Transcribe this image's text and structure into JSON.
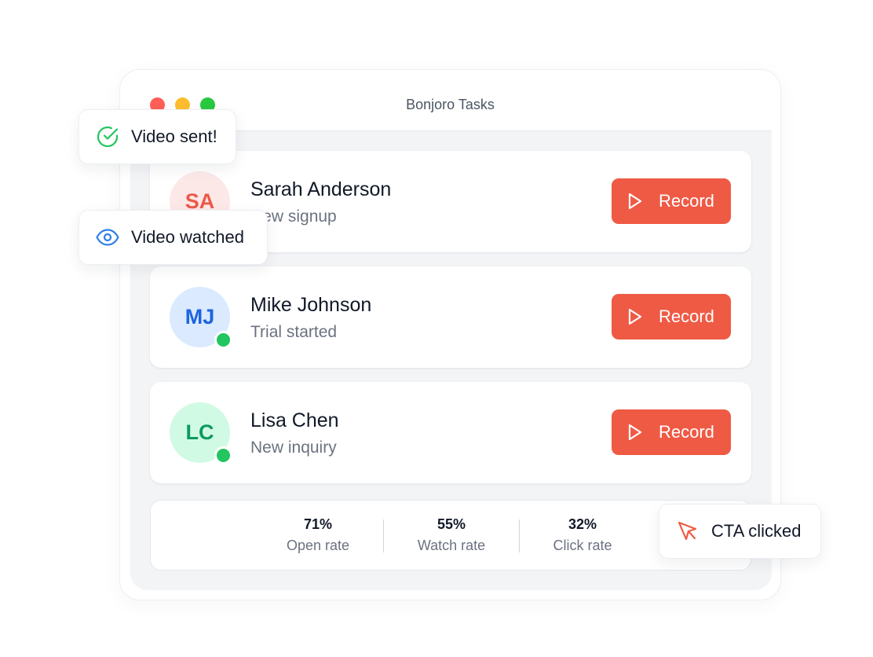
{
  "window": {
    "title": "Bonjoro Tasks"
  },
  "tasks": [
    {
      "initials": "SA",
      "name": "Sarah Anderson",
      "subtitle": "New signup",
      "action": "Record",
      "avatar_color": "#ea5a47",
      "online": false
    },
    {
      "initials": "MJ",
      "name": "Mike Johnson",
      "subtitle": "Trial started",
      "action": "Record",
      "avatar_color": "#1d64e0",
      "online": true
    },
    {
      "initials": "LC",
      "name": "Lisa Chen",
      "subtitle": "New inquiry",
      "action": "Record",
      "avatar_color": "#0f9a5f",
      "online": true
    }
  ],
  "stats": [
    {
      "value": "71%",
      "label": "Open rate"
    },
    {
      "value": "55%",
      "label": "Watch rate"
    },
    {
      "value": "32%",
      "label": "Click rate"
    }
  ],
  "notifications": {
    "video_sent": "Video sent!",
    "video_watched": "Video watched",
    "cta_clicked": "CTA clicked"
  },
  "colors": {
    "accent": "#ef5a45",
    "success": "#22c55e",
    "info": "#2f7fe6"
  }
}
